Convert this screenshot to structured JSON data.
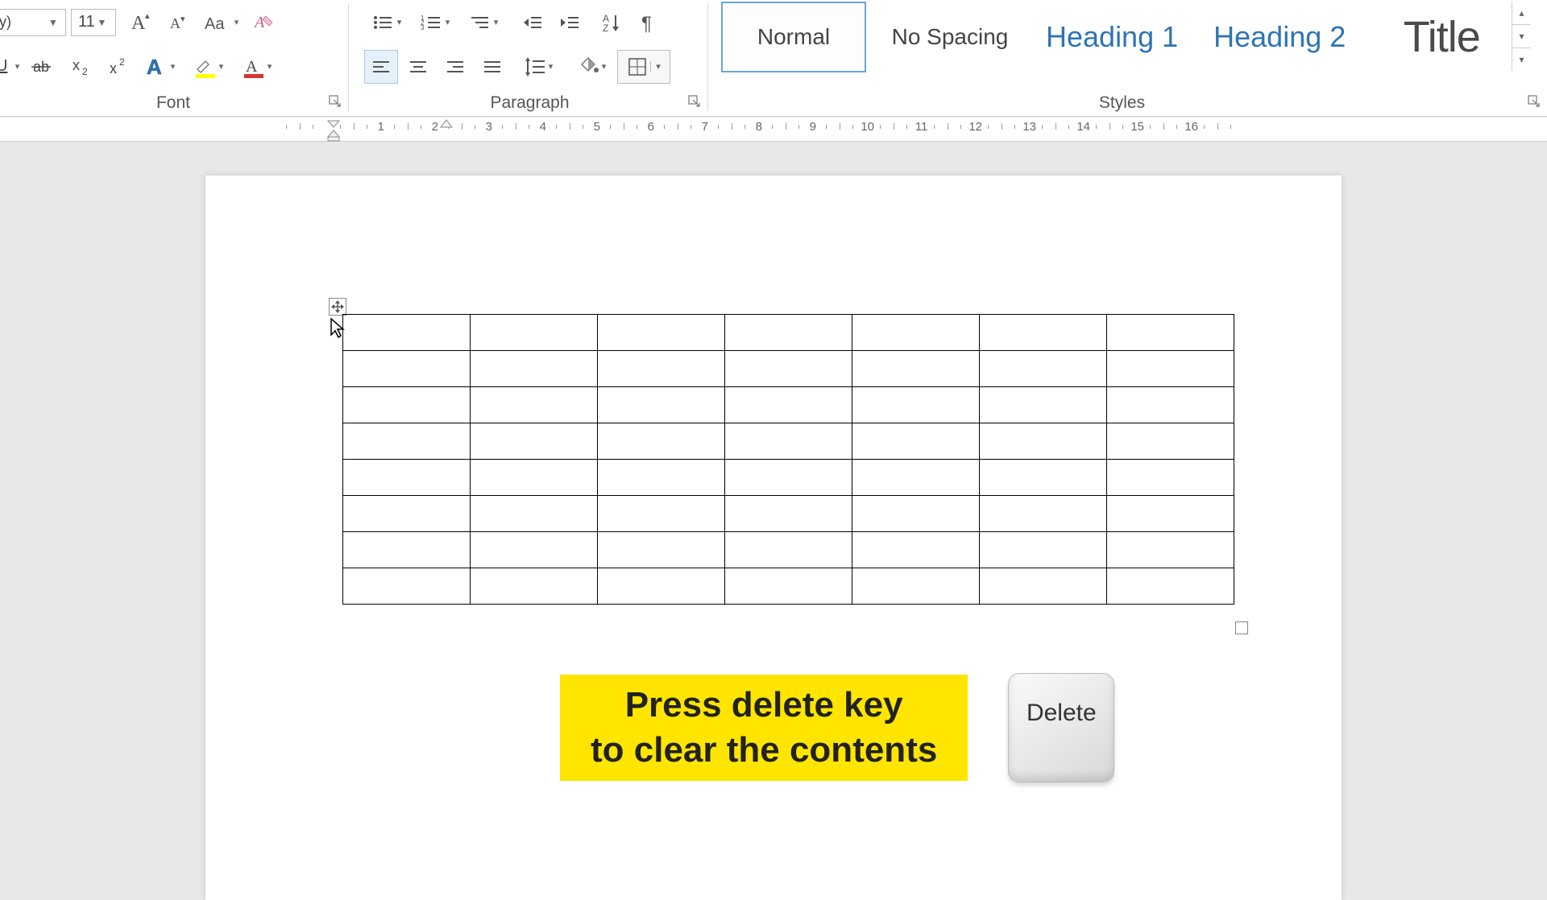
{
  "ribbon": {
    "font_name_fragment": "dy)",
    "font_size": "11",
    "group_font": "Font",
    "group_paragraph": "Paragraph",
    "group_styles": "Styles"
  },
  "styles": {
    "items": [
      {
        "label": "Normal"
      },
      {
        "label": "No Spacing"
      },
      {
        "label": "Heading 1"
      },
      {
        "label": "Heading 2"
      },
      {
        "label": "Title"
      }
    ]
  },
  "ruler": {
    "numbers": [
      "1",
      "2",
      "3",
      "4",
      "5",
      "6",
      "7",
      "8",
      "9",
      "10",
      "11",
      "12",
      "13",
      "14",
      "15",
      "16"
    ]
  },
  "table": {
    "rows": 8,
    "cols": 7
  },
  "callout": {
    "line1": "Press delete key",
    "line2": "to clear the contents"
  },
  "key": {
    "label": "Delete"
  }
}
